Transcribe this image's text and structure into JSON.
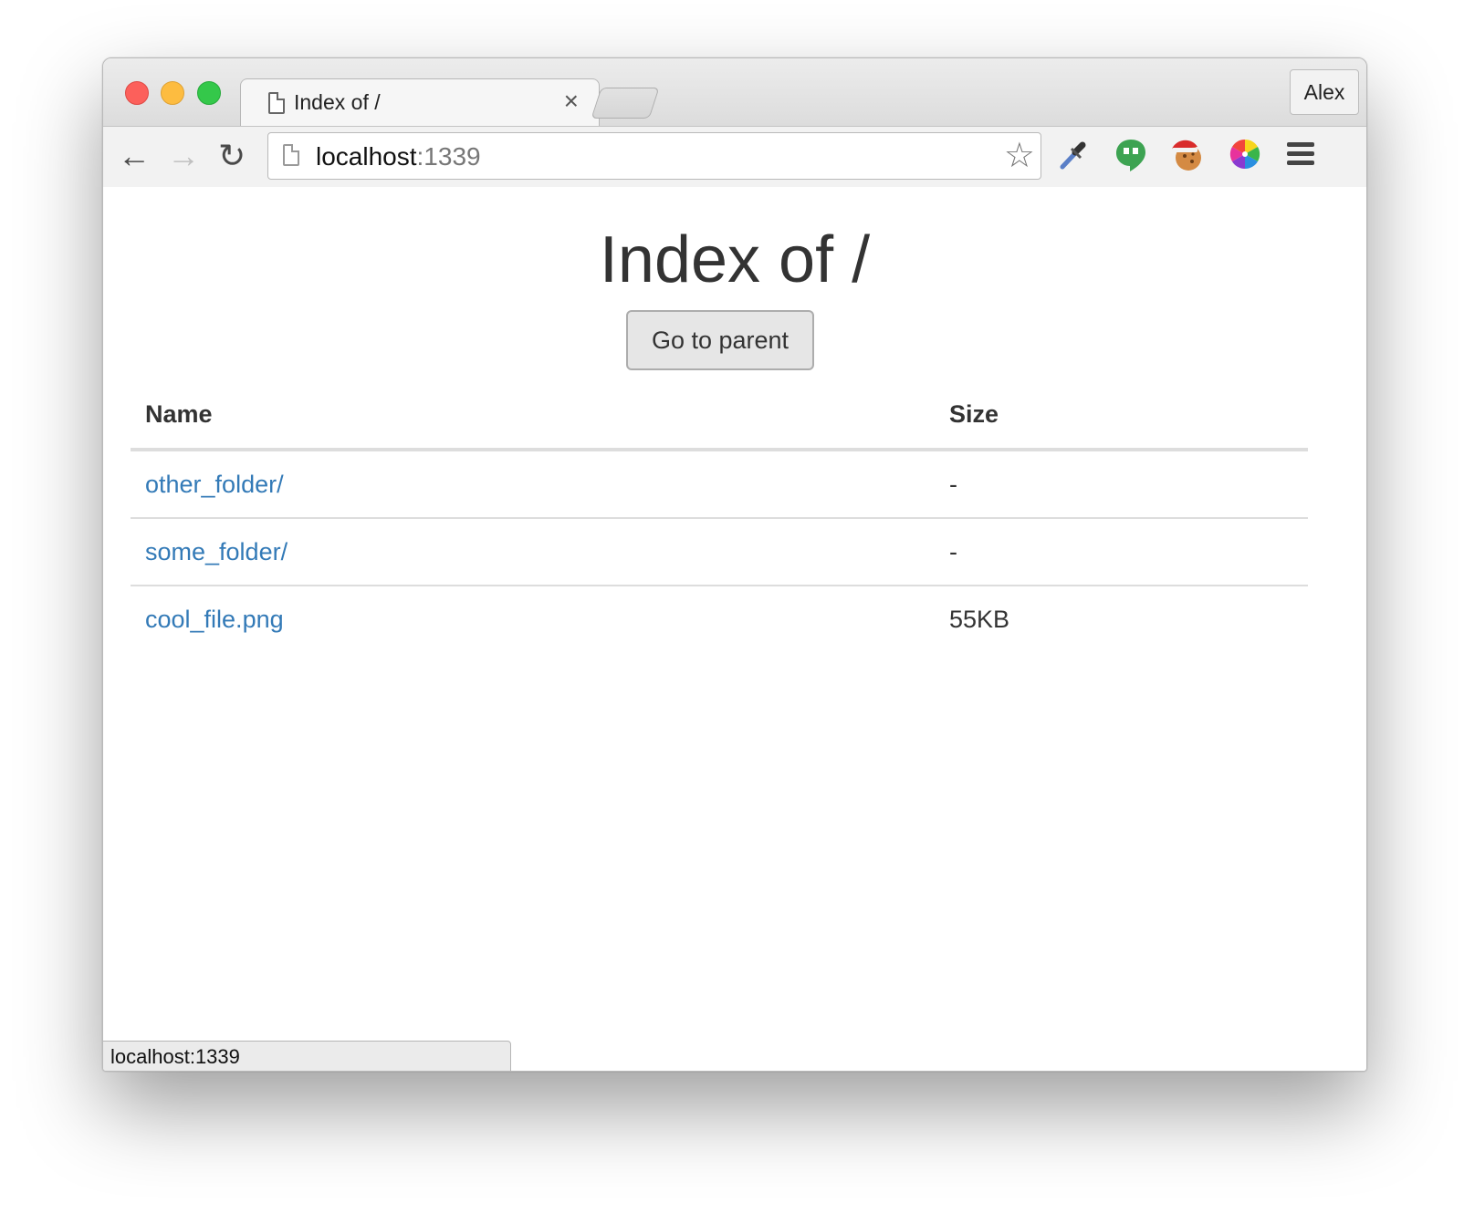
{
  "browser": {
    "tab": {
      "title": "Index of /",
      "close_glyph": "×"
    },
    "profile_name": "Alex",
    "omnibox": {
      "host": "localhost",
      "port": ":1339"
    },
    "status_bar_text": "localhost:1339",
    "icons": {
      "back": "←",
      "forward": "→",
      "reload": "↻",
      "star": "☆"
    }
  },
  "page": {
    "title": "Index of /",
    "parent_button_label": "Go to parent",
    "table": {
      "columns": [
        "Name",
        "Size"
      ],
      "rows": [
        {
          "name": "other_folder/",
          "size": "-"
        },
        {
          "name": "some_folder/",
          "size": "-"
        },
        {
          "name": "cool_file.png",
          "size": "55KB"
        }
      ]
    },
    "link_color": "#337ab7"
  }
}
